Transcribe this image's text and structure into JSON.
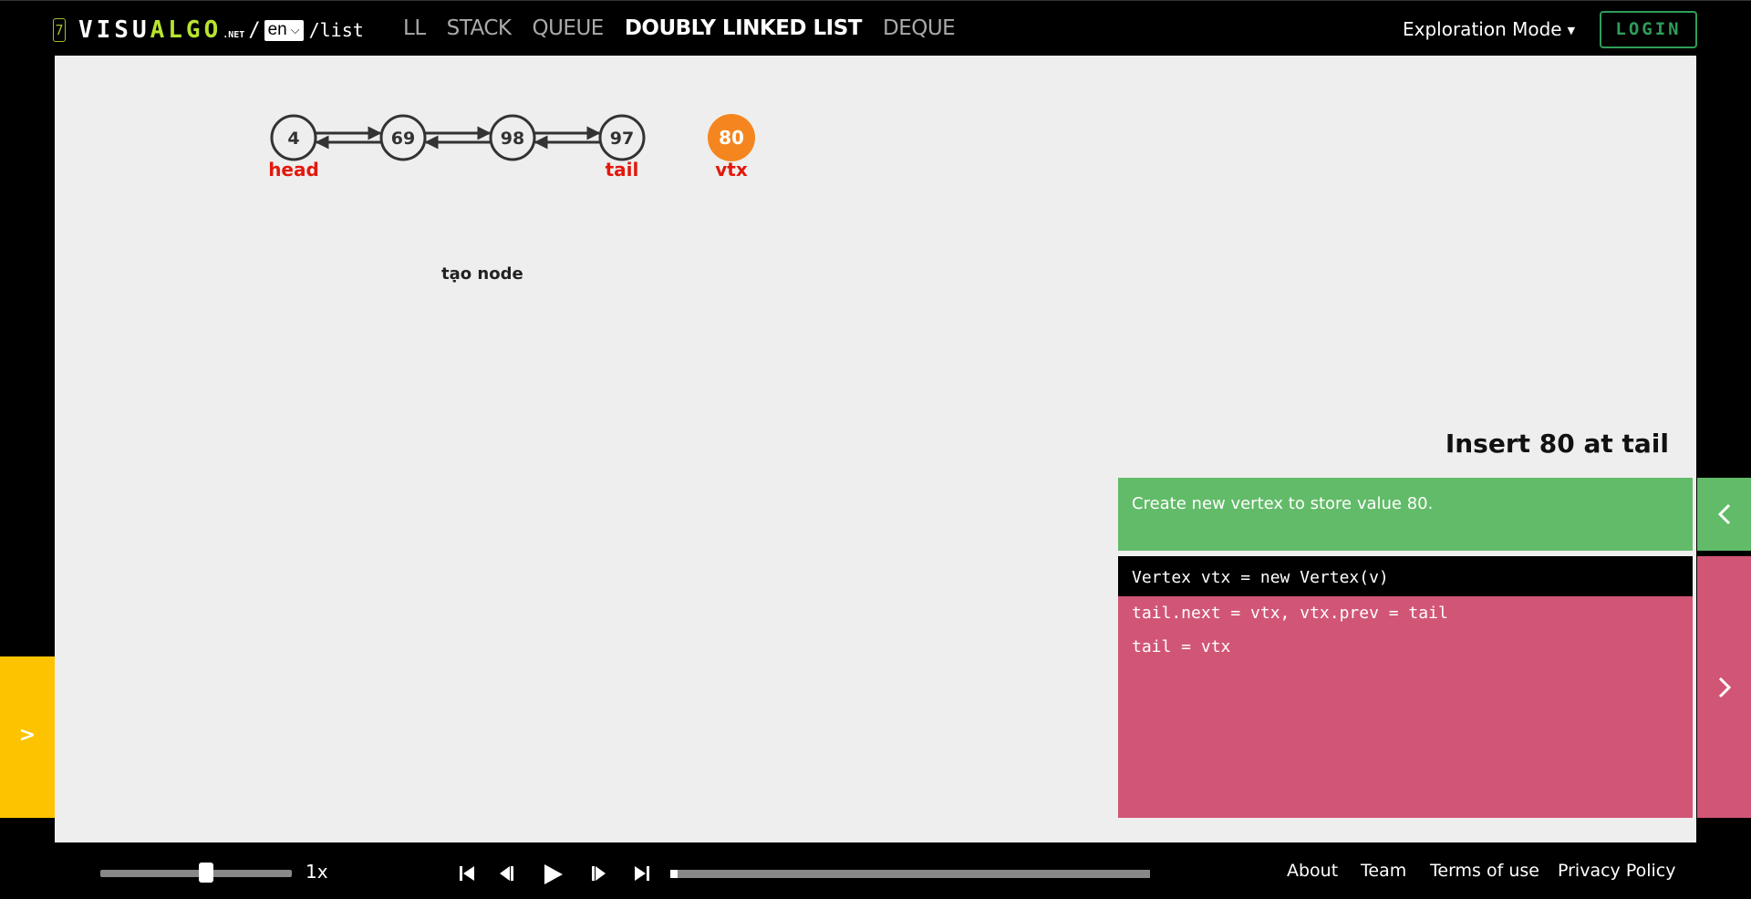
{
  "header": {
    "logo_number": "7",
    "logo_visu": "VISU",
    "logo_algo": "ALGO",
    "logo_net": ".NET",
    "logo_slash": "/",
    "language": "en",
    "path": "/list",
    "nav": [
      "LL",
      "STACK",
      "QUEUE",
      "DOUBLY LINKED LIST",
      "DEQUE"
    ],
    "active_nav": "DOUBLY LINKED LIST",
    "mode": "Exploration Mode",
    "login": "LOGIN"
  },
  "visualization": {
    "nodes": [
      {
        "value": "4",
        "label": "head"
      },
      {
        "value": "69",
        "label": ""
      },
      {
        "value": "98",
        "label": ""
      },
      {
        "value": "97",
        "label": "tail"
      }
    ],
    "new_vertex": {
      "value": "80",
      "label": "vtx"
    },
    "caption": "tạo node",
    "colors": {
      "node_stroke": "#333333",
      "label": "#e3180b",
      "new_vertex": "#f5861f"
    }
  },
  "operation": {
    "title": "Insert 80 at tail",
    "status": "Create new vertex to store value 80.",
    "code": [
      "Vertex vtx = new Vertex(v)",
      "tail.next = vtx, vtx.prev = tail",
      "tail = vtx"
    ],
    "highlighted_line": 0
  },
  "sidebar": {
    "toggle_label": ">"
  },
  "playback": {
    "speed_label": "1x",
    "speed_fraction": 0.55,
    "progress_fraction": 0.01
  },
  "footer": {
    "links": [
      "About",
      "Team",
      "Terms of use",
      "Privacy Policy"
    ]
  }
}
